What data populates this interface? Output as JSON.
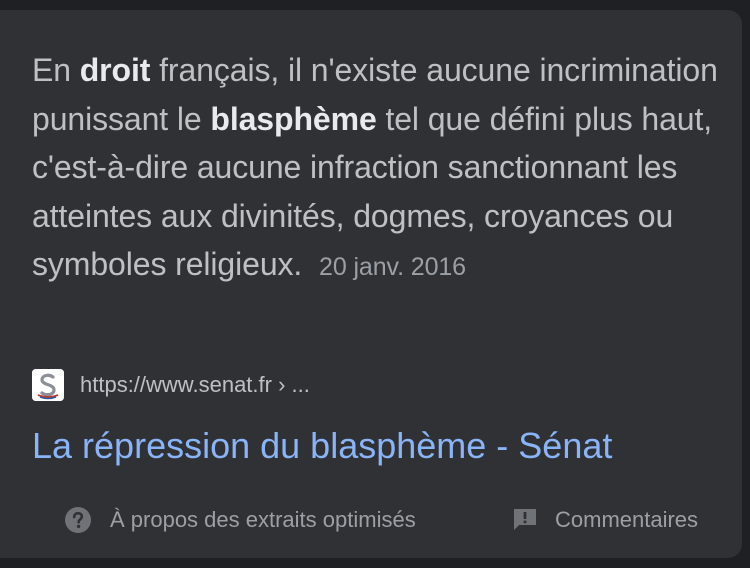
{
  "snippet": {
    "p1": "En ",
    "b1": "droit",
    "p2": " français, il n'existe aucune incrimination punissant le ",
    "b2": "blasphème",
    "p3": " tel que défini plus haut, c'est-à-dire aucune infraction sanctionnant les atteintes aux divinités, dogmes, croyances ou symboles religieux.",
    "date": "20 janv. 2016"
  },
  "source": {
    "favicon_icon": "senat-logo-icon",
    "url": "https://www.senat.fr › ..."
  },
  "result": {
    "title": "La répression du blasphème - Sénat"
  },
  "footer": {
    "about_icon": "question-circle-icon",
    "about_label": "À propos des extraits optimisés",
    "feedback_icon": "feedback-icon",
    "feedback_label": "Commentaires"
  },
  "colors": {
    "card_background": "#303134",
    "text": "#bdc1c6",
    "bold_text": "#e8eaed",
    "link": "#8ab4f8",
    "muted": "#9aa0a6"
  }
}
